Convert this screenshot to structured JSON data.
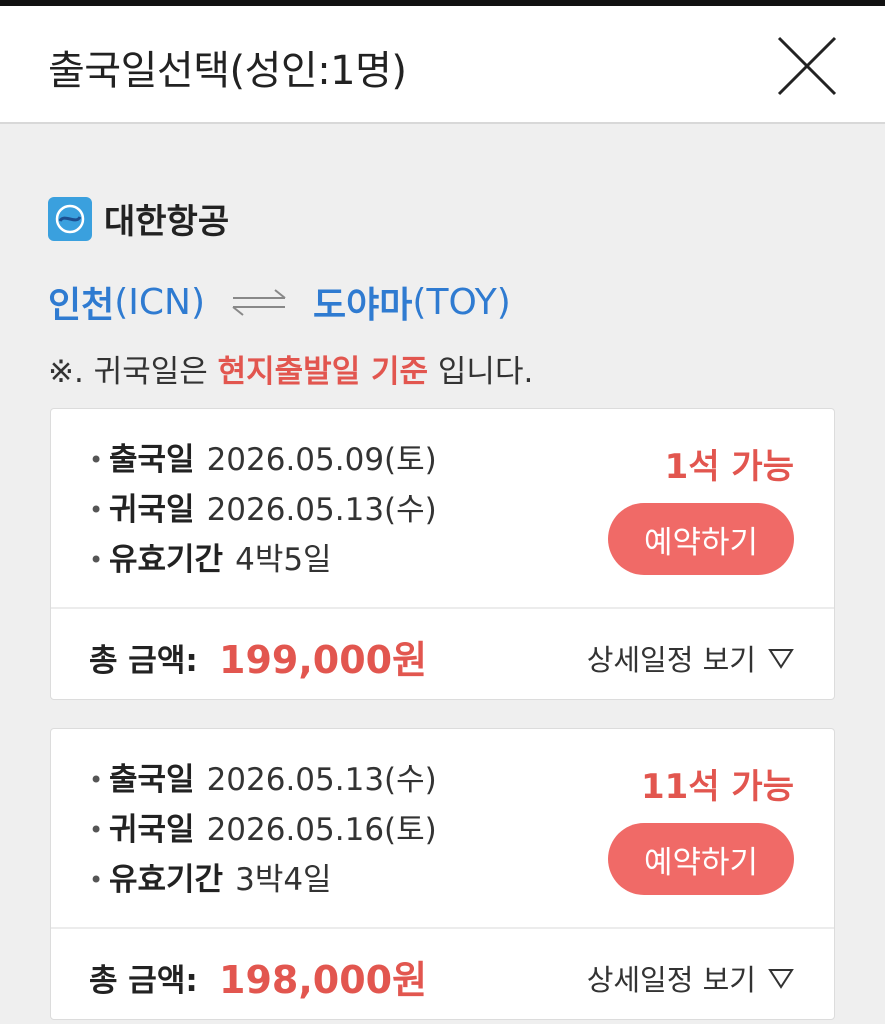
{
  "header": {
    "title": "출국일선택(성인:1명)"
  },
  "airline": {
    "name": "대한항공",
    "icon": "airline-logo-icon"
  },
  "route": {
    "origin_city": "인천",
    "origin_code": "(ICN)",
    "dest_city": "도야마",
    "dest_code": "(TOY)"
  },
  "notice": {
    "prefix": "※. 귀국일은 ",
    "highlight": "현지출발일 기준",
    "suffix": " 입니다."
  },
  "labels": {
    "depart": "출국일",
    "return": "귀국일",
    "validity": "유효기간",
    "total": "총 금액:",
    "book": "예약하기",
    "detail": "상세일정 보기"
  },
  "options": [
    {
      "depart_date": "2026.05.09(토)",
      "return_date": "2026.05.13(수)",
      "validity": "4박5일",
      "seats": "1석 가능",
      "price": "199,000원"
    },
    {
      "depart_date": "2026.05.13(수)",
      "return_date": "2026.05.16(토)",
      "validity": "3박4일",
      "seats": "11석 가능",
      "price": "198,000원"
    }
  ],
  "colors": {
    "accent": "#e2564f",
    "button": "#f06a67",
    "route": "#2f7bd1"
  }
}
